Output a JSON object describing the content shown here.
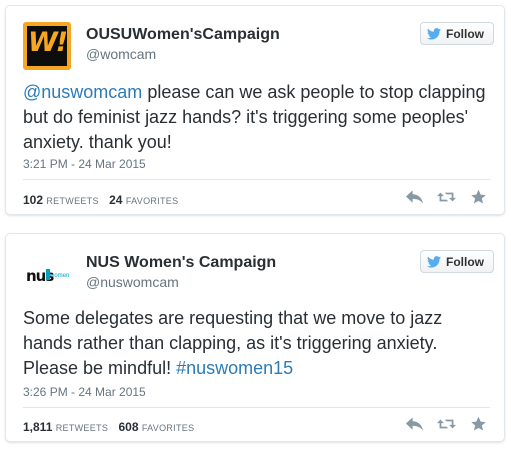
{
  "tweets": [
    {
      "display_name": "OUSUWomen'sCampaign",
      "handle": "@womcam",
      "avatar_text": "W!",
      "follow_label": "Follow",
      "mention": "@nuswomcam",
      "text_rest": " please can we ask people to stop clapping but do feminist jazz hands? it's triggering some peoples' anxiety. thank you!",
      "timestamp": "3:21 PM - 24 Mar 2015",
      "retweets": "102",
      "retweets_label": "RETWEETS",
      "favorites": "24",
      "favorites_label": "FAVORITES"
    },
    {
      "display_name": "NUS Women's Campaign",
      "handle": "@nuswomcam",
      "avatar_text": "nus",
      "avatar_subtext": "women",
      "follow_label": "Follow",
      "text_main": "Some delegates are requesting that we move to jazz hands rather than clapping, as it's triggering anxiety. Please be mindful! ",
      "hashtag": "#nuswomen15",
      "timestamp": "3:26 PM - 24 Mar 2015",
      "retweets": "1,811",
      "retweets_label": "RETWEETS",
      "favorites": "608",
      "favorites_label": "FAVORITES"
    }
  ],
  "icons": {
    "follow": "twitter-bird-icon",
    "reply": "reply-icon",
    "retweet": "retweet-icon",
    "favorite": "star-icon"
  },
  "colors": {
    "link": "#2b7bb9",
    "twitter_blue": "#55acee",
    "avatar_orange": "#f5a623",
    "nus_teal": "#00a0c6"
  }
}
